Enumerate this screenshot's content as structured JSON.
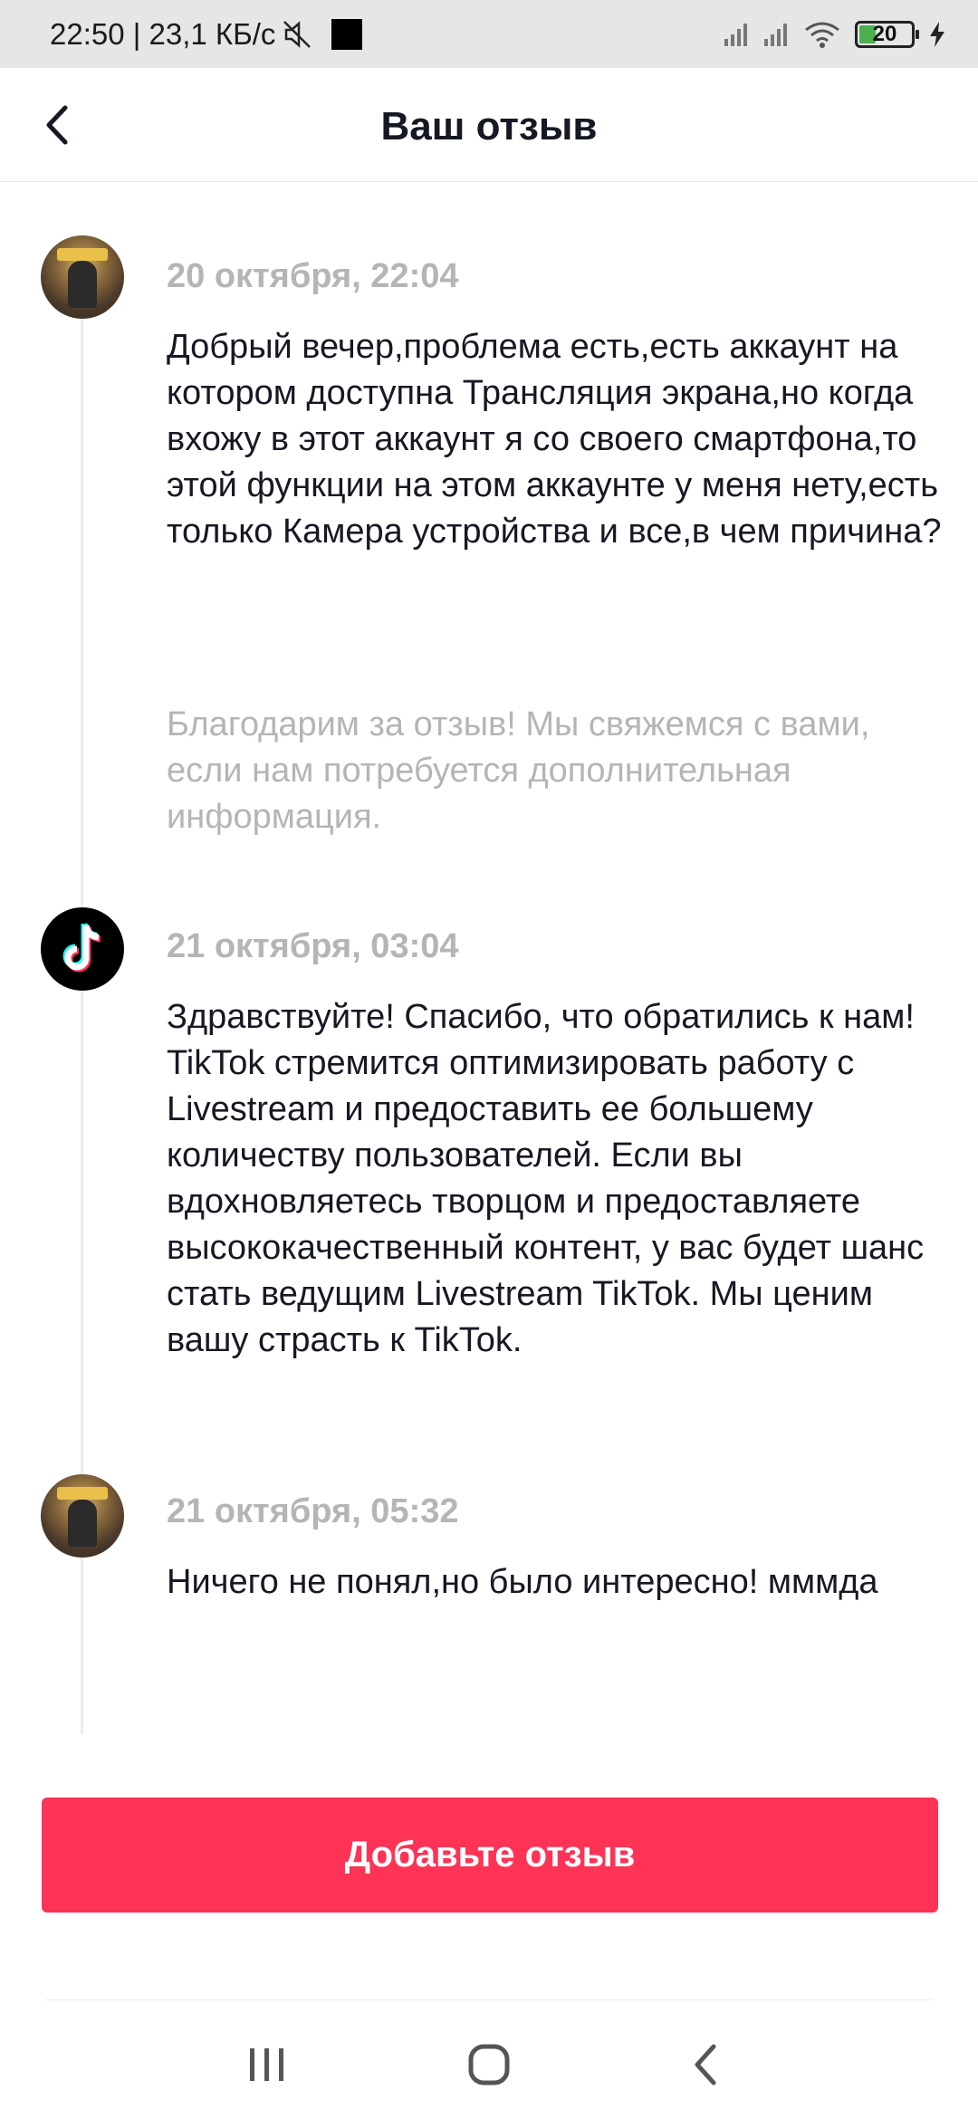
{
  "status_bar": {
    "time_speed": "22:50 | 23,1 КБ/с",
    "battery": "20"
  },
  "header": {
    "title": "Ваш отзыв"
  },
  "thread": [
    {
      "author": "user",
      "date": "20 октября, 22:04",
      "text": "Добрый вечер,проблема есть,есть аккаунт на котором доступна Трансляция экрана,но когда вхожу в этот аккаунт я со своего смартфона,то этой функции на этом аккаунте у меня нету,есть только Камера устройства и все,в чем причина?",
      "auto_reply": "Благодарим за отзыв! Мы свяжемся с вами, если нам потребуется дополнительная информация."
    },
    {
      "author": "tiktok",
      "date": "21 октября, 03:04",
      "text": "Здравствуйте! Спасибо, что обратились к нам! TikTok стремится оптимизировать работу с Livestream и предоставить ее большему количеству пользователей. Если вы вдохновляетесь творцом и предоставляете высококачественный контент, у вас будет шанс стать ведущим Livestream TikTok. Мы ценим вашу страсть к TikTok."
    },
    {
      "author": "user",
      "date": "21 октября, 05:32",
      "text": "Ничего не понял,но было интересно! мммда"
    }
  ],
  "footer": {
    "add_label": "Добавьте отзыв"
  },
  "colors": {
    "accent": "#fe3355",
    "date_gray": "#b5b5b8"
  }
}
